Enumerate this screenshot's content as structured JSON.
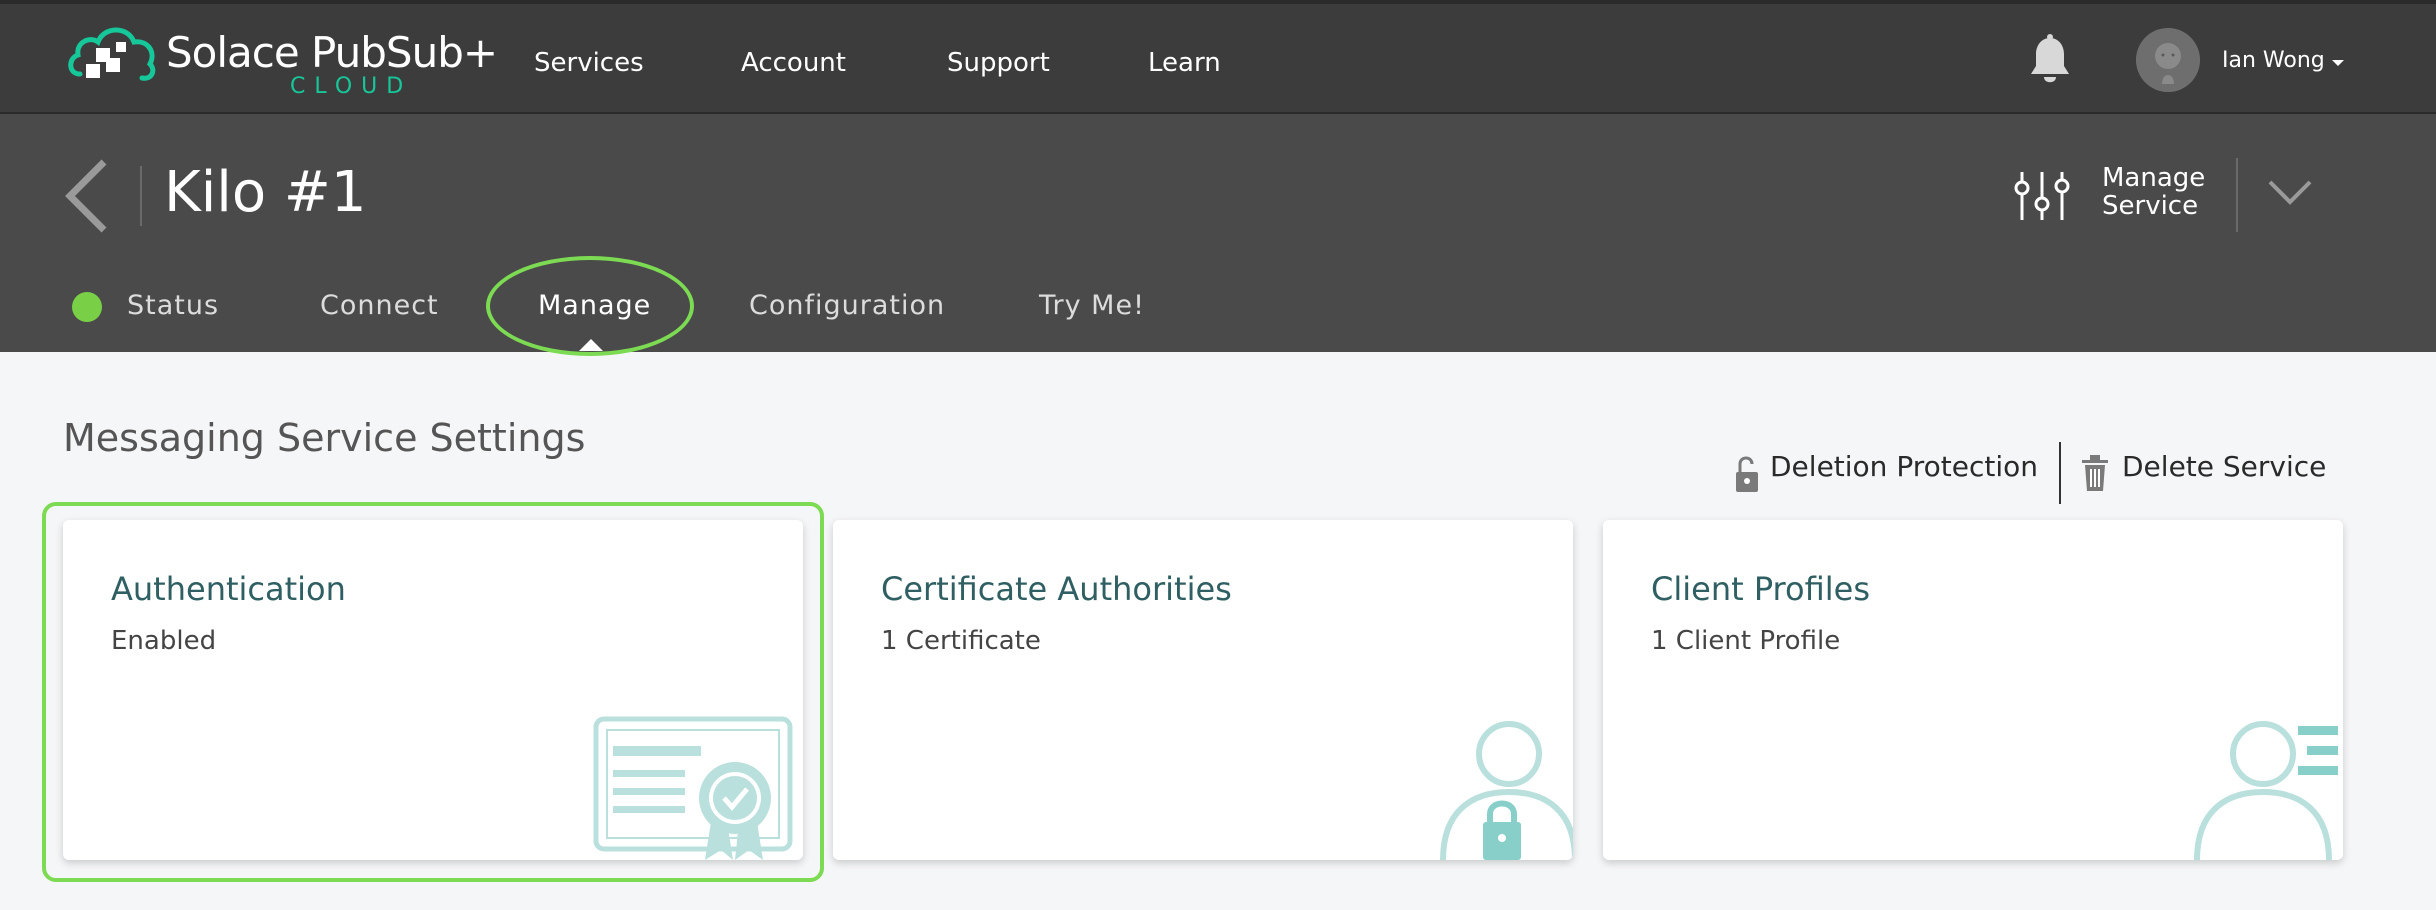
{
  "app": {
    "brand": "Solace PubSub+",
    "brand_sub": "CLOUD"
  },
  "nav": {
    "items": [
      {
        "label": "Services"
      },
      {
        "label": "Account"
      },
      {
        "label": "Support"
      },
      {
        "label": "Learn"
      }
    ],
    "user": {
      "name": "Ian Wong"
    }
  },
  "service": {
    "title": "Kilo #1",
    "manage_service_line1": "Manage",
    "manage_service_line2": "Service",
    "status_color": "#79d047",
    "tabs": [
      {
        "label": "Status"
      },
      {
        "label": "Connect"
      },
      {
        "label": "Manage",
        "selected": true
      },
      {
        "label": "Configuration"
      },
      {
        "label": "Try Me!"
      }
    ]
  },
  "main": {
    "section_title": "Messaging Service Settings",
    "actions": {
      "deletion_protection": "Deletion Protection",
      "delete_service": "Delete Service"
    },
    "cards": [
      {
        "title": "Authentication",
        "subtitle": "Enabled",
        "icon": "certificate-icon"
      },
      {
        "title": "Certificate Authorities",
        "subtitle": "1 Certificate",
        "icon": "user-lock-icon"
      },
      {
        "title": "Client Profiles",
        "subtitle": "1 Client Profile",
        "icon": "user-list-icon"
      }
    ]
  },
  "colors": {
    "topbar": "#3c3c3c",
    "header": "#4a4a4a",
    "accent_green": "#7cdb52",
    "brand_teal": "#16c79a",
    "card_title": "#2f5f62",
    "illustration": "#b9e0dd"
  }
}
